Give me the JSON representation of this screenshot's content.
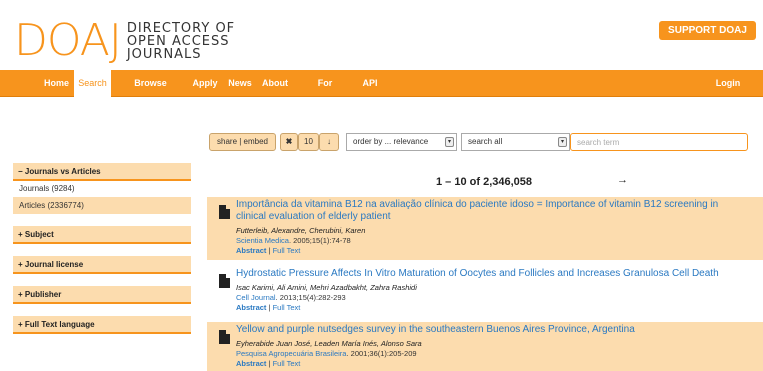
{
  "header": {
    "logo_letters": "DOAJ",
    "logo_lines": [
      "DIRECTORY OF",
      "OPEN ACCESS",
      "JOURNALS"
    ],
    "support_label": "SUPPORT DOAJ"
  },
  "nav": {
    "items": [
      "Home",
      "Search",
      "Browse Subjects",
      "Apply",
      "News",
      "About",
      "For Publishers",
      "API"
    ],
    "active": "Search",
    "login": "Login"
  },
  "toolbar": {
    "share_label": "share | embed",
    "clear_icon": "✖",
    "page_size": "10",
    "download_icon": "↓",
    "order_value": "order by ... relevance",
    "field_value": "search all",
    "search_placeholder": "search term"
  },
  "sidebar": {
    "journals_vs_articles": "− Journals vs Articles",
    "journals_count": "Journals (9284)",
    "articles_count": "Articles (2336774)",
    "subject": "+ Subject",
    "journal_license": "+ Journal license",
    "publisher": "+ Publisher",
    "full_text_language": "+ Full Text language"
  },
  "results": {
    "count_label": "1 – 10 of 2,346,058",
    "next_icon": "→",
    "items": [
      {
        "title": "Importância da vitamina B12 na avaliação clínica do paciente idoso = Importance of vitamin B12 screening in clinical evaluation of elderly patient",
        "authors": "Futterleib, Alexandre, Cherubini, Karen",
        "journal": "Scientia Medica",
        "citation": ". 2005;15(1):74-78",
        "abstract": "Abstract",
        "full_text": "Full Text"
      },
      {
        "title": "Hydrostatic Pressure Affects In Vitro Maturation of Oocytes and Follicles and Increases Granulosa Cell Death",
        "authors": "Isac Karimi, Ali Amini, Mehri Azadbakht, Zahra Rashidi",
        "journal": "Cell Journal",
        "citation": ". 2013;15(4):282-293",
        "abstract": "Abstract",
        "full_text": "Full Text"
      },
      {
        "title": "Yellow and purple nutsedges survey in the southeastern Buenos Aires Province, Argentina",
        "authors": "Eyherabide Juan José, Leaden María Inés, Alonso Sara",
        "journal": "Pesquisa Agropecuária Brasileira",
        "citation": ". 2001;36(1):205-209",
        "abstract": "Abstract",
        "full_text": "Full Text"
      }
    ]
  }
}
